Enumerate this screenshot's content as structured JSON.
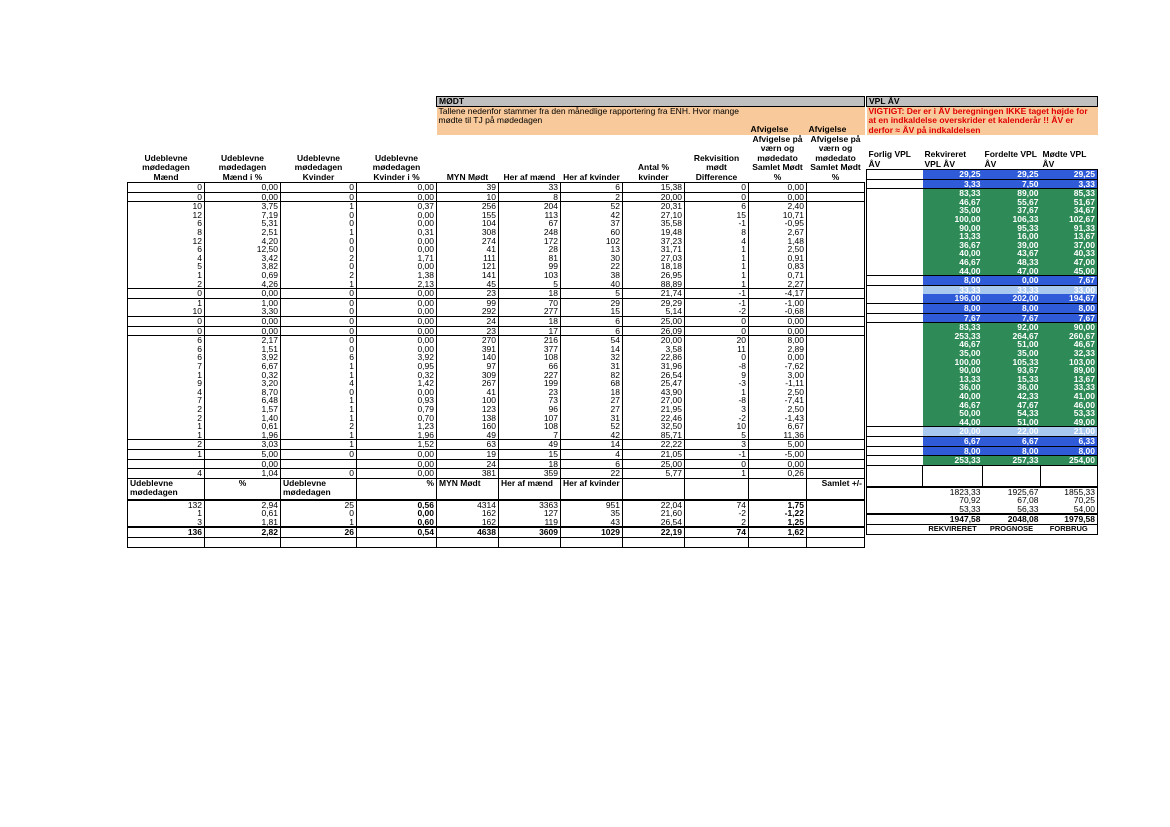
{
  "sections": {
    "modt_title": "MØDT",
    "modt_note": "Tallene nedenfor stammer fra den månedlige rapportering fra ENH. Hvor mange mødte til TJ på mødedagen",
    "vpl_title": "VPL ÅV",
    "vpl_warning": "VIGTIGT: Der er i ÅV beregningen IKKE taget højde for at en indkaldelse overskrider et kalenderår !! ÅV er derfor ≈ ÅV på indkaldelsen"
  },
  "headers": [
    "Udeblevne mødedagen Mænd",
    "Udeblevne mødedagen Mænd i %",
    "Udeblevne mødedagen Kvinder",
    "Udeblevne mødedagen Kvinder i %",
    "MYN Mødt",
    "Her af mænd",
    "Her af kvinder",
    "Antal % kvinder",
    "Rekvisition mødt Difference",
    "Afvigelse på værn og mødedato Samlet Mødt %",
    "Afvigelse på værn og mødedato Samlet Mødt %"
  ],
  "vpl_headers": [
    "Forlig VPL ÅV",
    "Rekvireret VPL ÅV",
    "Fordelte VPL ÅV",
    "Mødte VPL ÅV"
  ],
  "rows": [
    {
      "c": [
        "0",
        "0,00",
        "0",
        "0,00",
        "39",
        "33",
        "6",
        "15,38",
        "0",
        "0,00"
      ],
      "v": [
        "29,25",
        "29,25",
        "29,25"
      ],
      "s": "blue",
      "bt": true
    },
    {
      "c": [
        "0",
        "0,00",
        "0",
        "0,00",
        "10",
        "8",
        "2",
        "20,00",
        "0",
        "0,00"
      ],
      "v": [
        "3,33",
        "7,50",
        "3,33"
      ],
      "s": "blue",
      "bt": true
    },
    {
      "c": [
        "10",
        "3,75",
        "1",
        "0,37",
        "256",
        "204",
        "52",
        "20,31",
        "6",
        "2,40"
      ],
      "v": [
        "83,33",
        "89,00",
        "85,33"
      ],
      "s": "green",
      "bt": true
    },
    {
      "c": [
        "12",
        "7,19",
        "0",
        "0,00",
        "155",
        "113",
        "42",
        "27,10",
        "15",
        "10,71"
      ],
      "v": [
        "46,67",
        "55,67",
        "51,67"
      ],
      "s": "green"
    },
    {
      "c": [
        "6",
        "5,31",
        "0",
        "0,00",
        "104",
        "67",
        "37",
        "35,58",
        "-1",
        "-0,95"
      ],
      "v": [
        "35,00",
        "37,67",
        "34,67"
      ],
      "s": "green"
    },
    {
      "c": [
        "8",
        "2,51",
        "1",
        "0,31",
        "308",
        "248",
        "60",
        "19,48",
        "8",
        "2,67"
      ],
      "v": [
        "100,00",
        "106,33",
        "102,67"
      ],
      "s": "green"
    },
    {
      "c": [
        "12",
        "4,20",
        "0",
        "0,00",
        "274",
        "172",
        "102",
        "37,23",
        "4",
        "1,48"
      ],
      "v": [
        "90,00",
        "95,33",
        "91,33"
      ],
      "s": "green"
    },
    {
      "c": [
        "6",
        "12,50",
        "0",
        "0,00",
        "41",
        "28",
        "13",
        "31,71",
        "1",
        "2,50"
      ],
      "v": [
        "13,33",
        "16,00",
        "13,67"
      ],
      "s": "green"
    },
    {
      "c": [
        "4",
        "3,42",
        "2",
        "1,71",
        "111",
        "81",
        "30",
        "27,03",
        "1",
        "0,91"
      ],
      "v": [
        "36,67",
        "39,00",
        "37,00"
      ],
      "s": "green"
    },
    {
      "c": [
        "5",
        "3,82",
        "0",
        "0,00",
        "121",
        "99",
        "22",
        "18,18",
        "1",
        "0,83"
      ],
      "v": [
        "40,00",
        "43,67",
        "40,33"
      ],
      "s": "green"
    },
    {
      "c": [
        "1",
        "0,69",
        "2",
        "1,38",
        "141",
        "103",
        "38",
        "26,95",
        "1",
        "0,71"
      ],
      "v": [
        "46,67",
        "48,33",
        "47,00"
      ],
      "s": "green"
    },
    {
      "c": [
        "2",
        "4,26",
        "1",
        "2,13",
        "45",
        "5",
        "40",
        "88,89",
        "1",
        "2,27"
      ],
      "v": [
        "44,00",
        "47,00",
        "45,00"
      ],
      "s": "green"
    },
    {
      "c": [
        "0",
        "0,00",
        "0",
        "0,00",
        "23",
        "18",
        "5",
        "21,74",
        "-1",
        "-4,17"
      ],
      "v": [
        "8,00",
        "0,00",
        "7,67"
      ],
      "s": "blue",
      "bt": true
    },
    {
      "c": [
        "1",
        "1,00",
        "0",
        "0,00",
        "99",
        "70",
        "29",
        "29,29",
        "-1",
        "-1,00"
      ],
      "v": [
        "33,33",
        "33,33",
        "33,00"
      ],
      "s": "lblue",
      "bt": true
    },
    {
      "c": [
        "10",
        "3,30",
        "0",
        "0,00",
        "292",
        "277",
        "15",
        "5,14",
        "-2",
        "-0,68"
      ],
      "v": [
        "196,00",
        "202,00",
        "194,67"
      ],
      "s": "blue"
    },
    {
      "c": [
        "0",
        "0,00",
        "0",
        "0,00",
        "24",
        "18",
        "6",
        "25,00",
        "0",
        "0,00"
      ],
      "v": [
        "8,00",
        "8,00",
        "8,00"
      ],
      "s": "blue",
      "bt": true
    },
    {
      "c": [
        "0",
        "0,00",
        "0",
        "0,00",
        "23",
        "17",
        "6",
        "26,09",
        "0",
        "0,00"
      ],
      "v": [
        "7,67",
        "7,67",
        "7,67"
      ],
      "s": "blue",
      "bt": true
    },
    {
      "c": [
        "6",
        "2,17",
        "0",
        "0,00",
        "270",
        "216",
        "54",
        "20,00",
        "20",
        "8,00"
      ],
      "v": [
        "83,33",
        "92,00",
        "90,00"
      ],
      "s": "green",
      "bt": true
    },
    {
      "c": [
        "6",
        "1,51",
        "0",
        "0,00",
        "391",
        "377",
        "14",
        "3,58",
        "11",
        "2,89"
      ],
      "v": [
        "253,33",
        "264,67",
        "260,67"
      ],
      "s": "green"
    },
    {
      "c": [
        "6",
        "3,92",
        "6",
        "3,92",
        "140",
        "108",
        "32",
        "22,86",
        "0",
        "0,00"
      ],
      "v": [
        "46,67",
        "51,00",
        "46,67"
      ],
      "s": "green"
    },
    {
      "c": [
        "7",
        "6,67",
        "1",
        "0,95",
        "97",
        "66",
        "31",
        "31,96",
        "-8",
        "-7,62"
      ],
      "v": [
        "35,00",
        "35,00",
        "32,33"
      ],
      "s": "green"
    },
    {
      "c": [
        "1",
        "0,32",
        "1",
        "0,32",
        "309",
        "227",
        "82",
        "26,54",
        "9",
        "3,00"
      ],
      "v": [
        "100,00",
        "105,33",
        "103,00"
      ],
      "s": "green"
    },
    {
      "c": [
        "9",
        "3,20",
        "4",
        "1,42",
        "267",
        "199",
        "68",
        "25,47",
        "-3",
        "-1,11"
      ],
      "v": [
        "90,00",
        "93,67",
        "89,00"
      ],
      "s": "green"
    },
    {
      "c": [
        "4",
        "8,70",
        "0",
        "0,00",
        "41",
        "23",
        "18",
        "43,90",
        "1",
        "2,50"
      ],
      "v": [
        "13,33",
        "15,33",
        "13,67"
      ],
      "s": "green"
    },
    {
      "c": [
        "7",
        "6,48",
        "1",
        "0,93",
        "100",
        "73",
        "27",
        "27,00",
        "-8",
        "-7,41"
      ],
      "v": [
        "36,00",
        "36,00",
        "33,33"
      ],
      "s": "green"
    },
    {
      "c": [
        "2",
        "1,57",
        "1",
        "0,79",
        "123",
        "96",
        "27",
        "21,95",
        "3",
        "2,50"
      ],
      "v": [
        "40,00",
        "42,33",
        "41,00"
      ],
      "s": "green"
    },
    {
      "c": [
        "2",
        "1,40",
        "1",
        "0,70",
        "138",
        "107",
        "31",
        "22,46",
        "-2",
        "-1,43"
      ],
      "v": [
        "46,67",
        "47,67",
        "46,00"
      ],
      "s": "green"
    },
    {
      "c": [
        "1",
        "0,61",
        "2",
        "1,23",
        "160",
        "108",
        "52",
        "32,50",
        "10",
        "6,67"
      ],
      "v": [
        "50,00",
        "54,33",
        "53,33"
      ],
      "s": "green"
    },
    {
      "c": [
        "1",
        "1,96",
        "1",
        "1,96",
        "49",
        "7",
        "42",
        "85,71",
        "5",
        "11,36"
      ],
      "v": [
        "44,00",
        "51,00",
        "49,00"
      ],
      "s": "green"
    },
    {
      "c": [
        "2",
        "3,03",
        "1",
        "1,52",
        "63",
        "49",
        "14",
        "22,22",
        "3",
        "5,00"
      ],
      "v": [
        "20,00",
        "22,00",
        "21,00"
      ],
      "s": "lblue",
      "bt": true
    },
    {
      "c": [
        "1",
        "5,00",
        "0",
        "0,00",
        "19",
        "15",
        "4",
        "21,05",
        "-1",
        "-5,00"
      ],
      "v": [
        "6,67",
        "6,67",
        "6,33"
      ],
      "s": "blue",
      "bt": true
    },
    {
      "c": [
        "",
        "0,00",
        "",
        "0,00",
        "24",
        "18",
        "6",
        "25,00",
        "0",
        "0,00"
      ],
      "v": [
        "8,00",
        "8,00",
        "8,00"
      ],
      "s": "blue",
      "bt": true
    },
    {
      "c": [
        "4",
        "1,04",
        "0",
        "0,00",
        "381",
        "359",
        "22",
        "5,77",
        "1",
        "0,26"
      ],
      "v": [
        "253,33",
        "257,33",
        "254,00"
      ],
      "s": "green",
      "bt": true
    }
  ],
  "subheader": [
    "Udeblevne mødedagen",
    "%",
    "Udeblevne mødedagen",
    "%",
    "MYN Mødt",
    "Her af mænd",
    "Her af kvinder",
    "",
    "",
    "",
    "Samlet +/-"
  ],
  "summary": [
    {
      "c": [
        "132",
        "2,94",
        "25",
        "0,56",
        "4314",
        "3363",
        "951",
        "22,04",
        "74",
        "1,75"
      ],
      "v": [
        "1823,33",
        "1925,67",
        "1855,33"
      ]
    },
    {
      "c": [
        "1",
        "0,61",
        "0",
        "0,00",
        "162",
        "127",
        "35",
        "21,60",
        "-2",
        "-1,22"
      ],
      "v": [
        "70,92",
        "67,08",
        "70,25"
      ]
    },
    {
      "c": [
        "3",
        "1,81",
        "1",
        "0,60",
        "162",
        "119",
        "43",
        "26,54",
        "2",
        "1,25"
      ],
      "v": [
        "53,33",
        "56,33",
        "54,00"
      ]
    },
    {
      "c": [
        "136",
        "2,82",
        "26",
        "0,54",
        "4638",
        "3609",
        "1029",
        "22,19",
        "74",
        "1,62"
      ],
      "v": [
        "1947,58",
        "2048,08",
        "1979,58"
      ]
    }
  ],
  "footer": [
    "REKVIRERET",
    "PROGNOSE",
    "FORBRUG"
  ],
  "colors": {
    "green": "#2e8b57",
    "blue": "#2f5bd8",
    "light_blue": "#a8c8f0",
    "note": "#f8c99a",
    "section": "#c0c0c0",
    "warning_text": "#e00000"
  }
}
